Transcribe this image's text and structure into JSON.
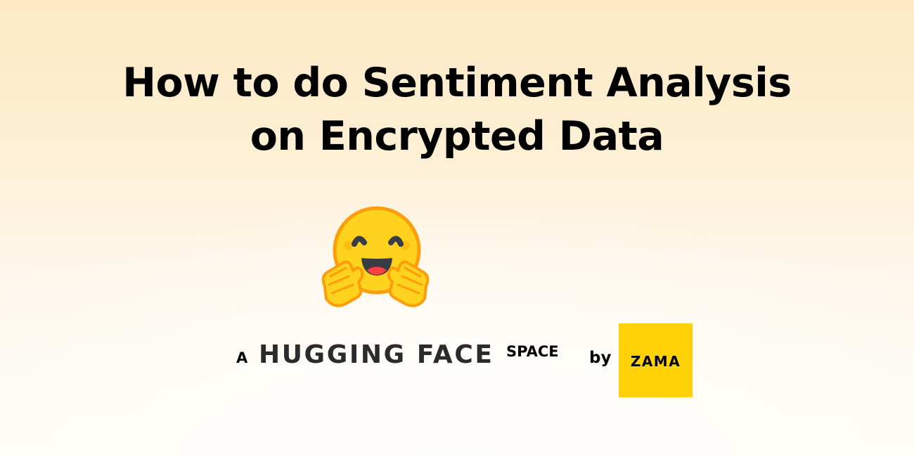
{
  "title": {
    "line1": "How to do Sentiment Analysis",
    "line2": "on Encrypted Data"
  },
  "logo": {
    "icon": "hugging-face-emoji-icon"
  },
  "byline": {
    "prefix": "A",
    "brand": "HUGGING FACE",
    "suffix": "SPACE",
    "by": "by",
    "company": "ZAMA"
  },
  "colors": {
    "background_top": "#fde9c4",
    "background_bottom": "#fffdf9",
    "zama_yellow": "#ffd208",
    "emoji_yellow": "#ffd21e",
    "emoji_orange": "#ff9d0b",
    "text": "#000000"
  }
}
